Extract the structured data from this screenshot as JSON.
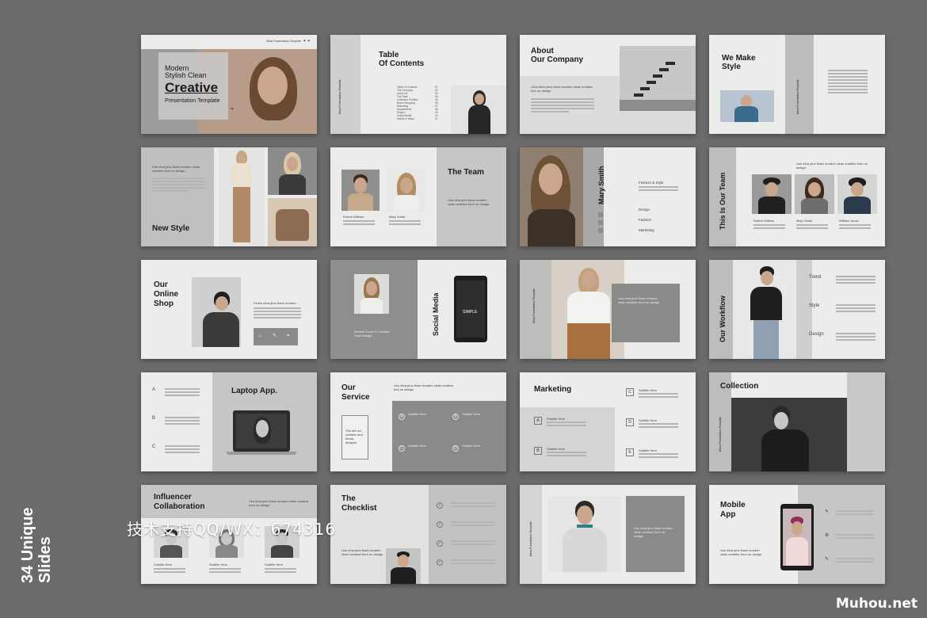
{
  "side_caption": {
    "line1": "34 Unique",
    "line2": "Slides"
  },
  "watermark": "技术支持QQ/WX：674316",
  "brand": "Muhou.net",
  "s1": {
    "top_label": "Mara Presentation Template",
    "l1": "Modern",
    "l2": "Stylish Clean",
    "big": "Creative",
    "sub": "Presentation Template"
  },
  "s2": {
    "title1": "Table",
    "title2": "Of Contents",
    "side": "Mara Presentation Template",
    "items": [
      "Table Of Contents",
      "The Company",
      "About Us",
      "The Team",
      "Collection Portfolio",
      "Brand Shopping",
      "Marketing",
      "Departments",
      "Project",
      "Social Media",
      "Mobile & Vision"
    ],
    "nums": [
      "01",
      "02",
      "03",
      "04",
      "05",
      "06",
      "07",
      "08",
      "09",
      "10",
      "11"
    ]
  },
  "s3": {
    "title1": "About",
    "title2": "Our Company",
    "text": "Urna etna pens flown modern clean creative font on design."
  },
  "s4": {
    "title1": "We Make",
    "title2": "Style",
    "side": "Mara Presentation Template"
  },
  "s5": {
    "title": "New Style",
    "text": "Uns etna jens flown modern clean creative form on design."
  },
  "s6": {
    "title": "The Team",
    "n1": "Robert William",
    "n2": "Mary Smith",
    "text": "Uns etna jens flown modern clean creative form on design."
  },
  "s7": {
    "name": "Mary Smith",
    "i1": "Fashion & Style",
    "i2": "Design",
    "i3": "Fashion",
    "i4": "Marketing"
  },
  "s8": {
    "title": "This Is Our Team",
    "text": "Uns etna jens flown modern clean creative form on design.",
    "n1": "Robert William",
    "n2": "Mary Smith",
    "n3": "William Jones"
  },
  "s9": {
    "title1": "Our",
    "title2": "Online",
    "title3": "Shop",
    "text": "Fimbe etna jens flown modern"
  },
  "s10": {
    "title": "Social Media",
    "text": "Modern Clean & Creative Style Design",
    "phone": "SIMPLE"
  },
  "s11": {
    "side": "Mara Presentation Template",
    "text": "Uns etna jens flown modern clean creative form on design."
  },
  "s12": {
    "title": "Our Workflow",
    "t1": "Trend",
    "t2": "Style",
    "t3": "Design"
  },
  "s13": {
    "title": "Laptop App.",
    "a": "A",
    "b": "B",
    "c": "C"
  },
  "s14": {
    "title1": "Our",
    "title2": "Service",
    "text": "Uns etna jens flown modern clean creative font on design.",
    "box": "The are our creative and forma designs.",
    "sub": "Subtitle Here",
    "a": "A",
    "b": "B",
    "c": "C",
    "d": "D"
  },
  "s15": {
    "title": "Marketing",
    "sub": "Subtitle Here",
    "a": "A",
    "b": "B",
    "c": "C",
    "d": "D",
    "e": "E"
  },
  "s16": {
    "title": "Collection",
    "side": "Mara Presentation Template"
  },
  "s17": {
    "title1": "Influencer",
    "title2": "Collaboration",
    "text": "Uns etna jens flown modern clean creative form on design.",
    "sub": "Subtitle Here"
  },
  "s18": {
    "title1": "The",
    "title2": "Checklist",
    "text": "Uns etna jens flown modern clean creative form on design."
  },
  "s19": {
    "side": "Mara Presentation Template",
    "text": "Uns etna jens flown modern clean creative form on design."
  },
  "s20": {
    "title1": "Mobile",
    "title2": "App",
    "text": "Uns etna jens flown modern clean creative form on design."
  }
}
